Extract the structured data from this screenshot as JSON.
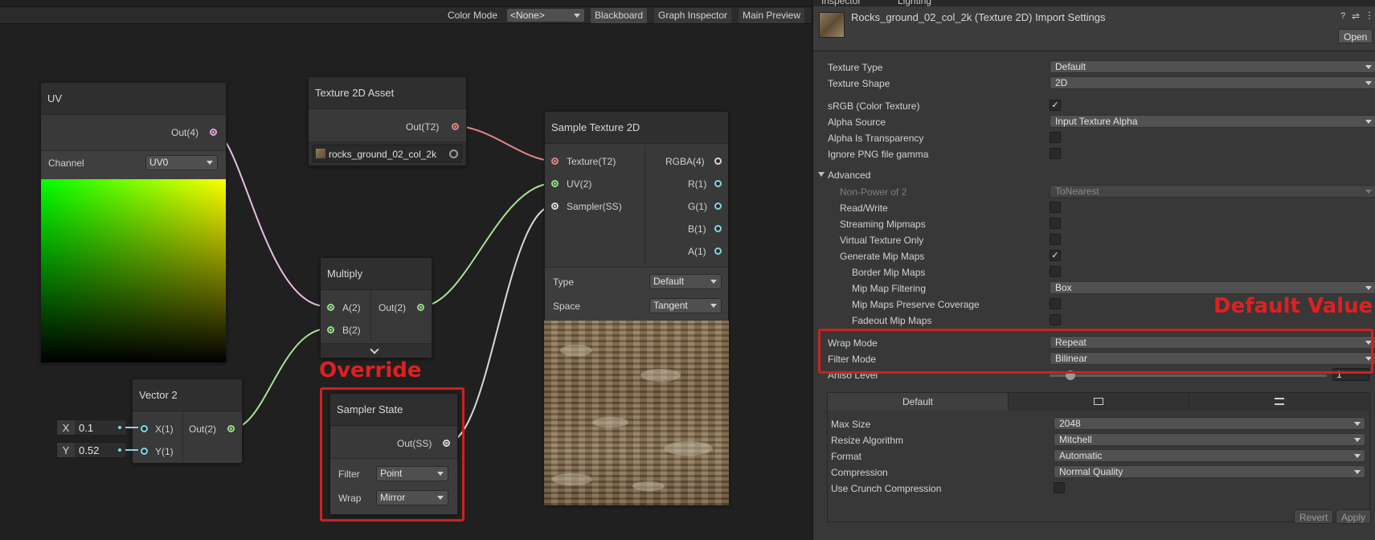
{
  "toolbar": {
    "color_mode_label": "Color Mode",
    "color_mode_value": "<None>",
    "blackboard": "Blackboard",
    "graph_inspector": "Graph Inspector",
    "main_preview": "Main Preview"
  },
  "nodes": {
    "uv": {
      "title": "UV",
      "out_port": "Out(4)",
      "channel_label": "Channel",
      "channel_value": "UV0"
    },
    "texture_asset": {
      "title": "Texture 2D Asset",
      "out_port": "Out(T2)",
      "asset_name": "rocks_ground_02_col_2k"
    },
    "sample_texture": {
      "title": "Sample Texture 2D",
      "inputs": [
        "Texture(T2)",
        "UV(2)",
        "Sampler(SS)"
      ],
      "outputs": [
        "RGBA(4)",
        "R(1)",
        "G(1)",
        "B(1)",
        "A(1)"
      ],
      "type_label": "Type",
      "type_value": "Default",
      "space_label": "Space",
      "space_value": "Tangent"
    },
    "multiply": {
      "title": "Multiply",
      "input_a": "A(2)",
      "input_b": "B(2)",
      "out_port": "Out(2)"
    },
    "vector2": {
      "title": "Vector 2",
      "input_x": "X(1)",
      "input_y": "Y(1)",
      "out_port": "Out(2)",
      "x_label": "X",
      "x_value": "0.1",
      "y_label": "Y",
      "y_value": "0.52"
    },
    "sampler_state": {
      "title": "Sampler State",
      "out_port": "Out(SS)",
      "filter_label": "Filter",
      "filter_value": "Point",
      "wrap_label": "Wrap",
      "wrap_value": "Mirror"
    }
  },
  "annotations": {
    "override": "Override",
    "default_value": "Default Value"
  },
  "inspector": {
    "tabs": [
      "Inspector",
      "Lighting"
    ],
    "title": "Rocks_ground_02_col_2k (Texture 2D) Import Settings",
    "open_button": "Open",
    "rows": [
      {
        "label": "Texture Type",
        "dropdown": "Default"
      },
      {
        "label": "Texture Shape",
        "dropdown": "2D"
      },
      {
        "label": "sRGB (Color Texture)",
        "checked": true
      },
      {
        "label": "Alpha Source",
        "dropdown": "Input Texture Alpha"
      },
      {
        "label": "Alpha Is Transparency",
        "checked": false
      },
      {
        "label": "Ignore PNG file gamma",
        "checked": false
      }
    ],
    "advanced_label": "Advanced",
    "advanced_rows": [
      {
        "label": "Non-Power of 2",
        "dropdown": "ToNearest"
      },
      {
        "label": "Read/Write",
        "checked": false
      },
      {
        "label": "Streaming Mipmaps",
        "checked": false
      },
      {
        "label": "Virtual Texture Only",
        "checked": false
      },
      {
        "label": "Generate Mip Maps",
        "checked": true
      },
      {
        "label": "Border Mip Maps",
        "checked": false
      },
      {
        "label": "Mip Map Filtering",
        "dropdown": "Box"
      },
      {
        "label": "Mip Maps Preserve Coverage",
        "checked": false
      },
      {
        "label": "Fadeout Mip Maps",
        "checked": false
      }
    ],
    "wrap_mode_label": "Wrap Mode",
    "wrap_mode_value": "Repeat",
    "filter_mode_label": "Filter Mode",
    "filter_mode_value": "Bilinear",
    "aniso_label": "Aniso Level",
    "aniso_value": "1",
    "platform": {
      "tab_default": "Default",
      "rows": [
        {
          "label": "Max Size",
          "dropdown": "2048"
        },
        {
          "label": "Resize Algorithm",
          "dropdown": "Mitchell"
        },
        {
          "label": "Format",
          "dropdown": "Automatic"
        },
        {
          "label": "Compression",
          "dropdown": "Normal Quality"
        },
        {
          "label": "Use Crunch Compression",
          "checked": false
        }
      ]
    },
    "revert_button": "Revert",
    "apply_button": "Apply"
  }
}
